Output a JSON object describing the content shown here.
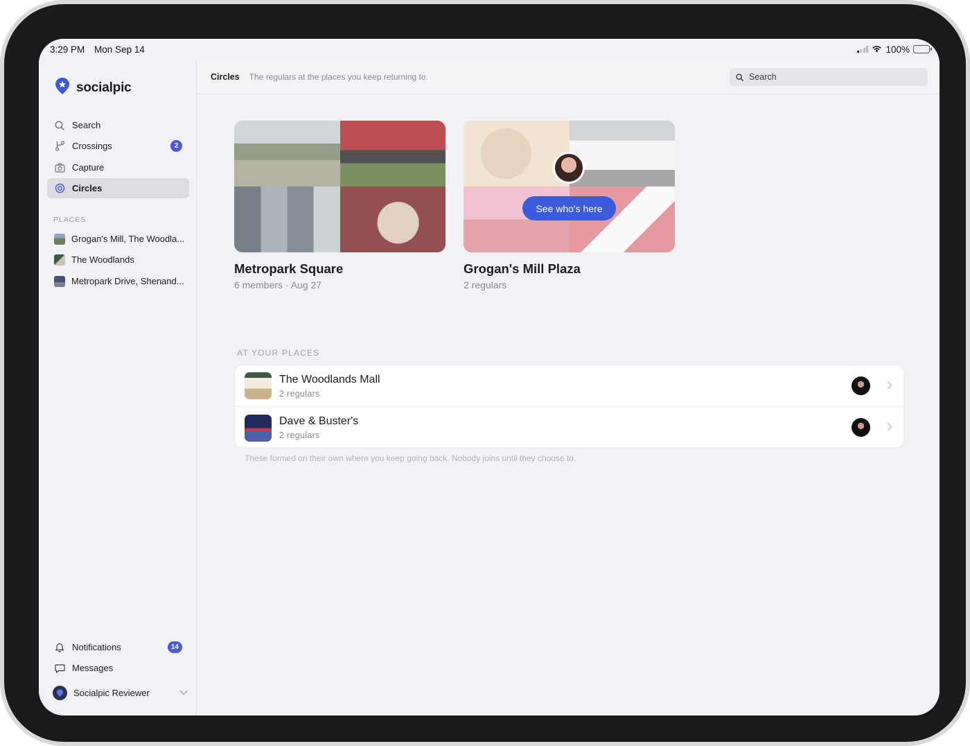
{
  "status": {
    "time": "3:29 PM",
    "date": "Mon Sep 14",
    "battery": "100%"
  },
  "brand": {
    "name": "socialpic",
    "icon": "location-pin-star-icon",
    "accent": "#3b5bdb"
  },
  "sidebar": {
    "nav": [
      {
        "label": "Search",
        "icon": "search-icon"
      },
      {
        "label": "Crossings",
        "icon": "branch-icon",
        "badge": "2"
      },
      {
        "label": "Capture",
        "icon": "camera-icon"
      },
      {
        "label": "Circles",
        "icon": "circle-target-icon",
        "active": true
      }
    ],
    "places_label": "PLACES",
    "places": [
      {
        "label": "Grogan's Mill, The Woodla..."
      },
      {
        "label": "The Woodlands"
      },
      {
        "label": "Metropark Drive, Shenand..."
      }
    ],
    "bottom": [
      {
        "label": "Notifications",
        "icon": "bell-icon",
        "badge": "14"
      },
      {
        "label": "Messages",
        "icon": "message-icon"
      }
    ],
    "user": {
      "name": "Socialpic Reviewer"
    }
  },
  "topbar": {
    "title": "Circles",
    "subtitle": "The regulars at the places you keep returning to.",
    "search_placeholder": "Search"
  },
  "cards": [
    {
      "title": "Metropark Square",
      "meta": "6 members · Aug 27"
    },
    {
      "title": "Grogan's Mill Plaza",
      "meta": "2 regulars",
      "cta": "See who's here"
    }
  ],
  "at_places": {
    "label": "AT YOUR PLACES",
    "rows": [
      {
        "title": "The Woodlands Mall",
        "subtitle": "2 regulars"
      },
      {
        "title": "Dave & Buster's",
        "subtitle": "2 regulars"
      }
    ],
    "footnote": "These formed on their own where you keep going back. Nobody joins until they choose to."
  }
}
